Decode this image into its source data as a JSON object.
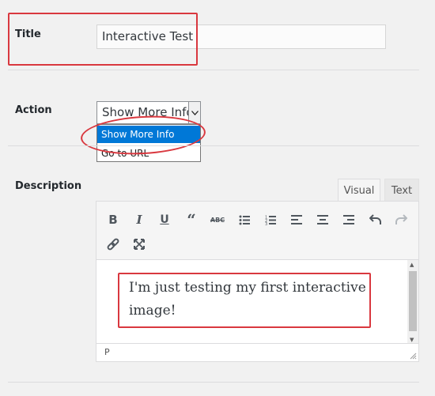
{
  "title_field": {
    "label": "Title",
    "value": "Interactive Test"
  },
  "action_field": {
    "label": "Action",
    "selected": "Show More Info",
    "options": [
      "Show More Info",
      "Go to URL"
    ]
  },
  "description_field": {
    "label": "Description",
    "tabs": {
      "visual": "Visual",
      "text": "Text"
    },
    "toolbar": [
      "bold-icon",
      "italic-icon",
      "underline-icon",
      "blockquote-icon",
      "strikethrough-icon",
      "bulleted-list-icon",
      "numbered-list-icon",
      "align-left-icon",
      "align-center-icon",
      "align-right-icon",
      "undo-icon",
      "redo-icon",
      "insert-link-icon",
      "fullscreen-icon"
    ],
    "content": "I'm just testing my first interactive image!",
    "path": "P"
  },
  "colors": {
    "highlight": "#d9383f",
    "selected_option": "#0078d7",
    "background": "#f1f1f1"
  }
}
